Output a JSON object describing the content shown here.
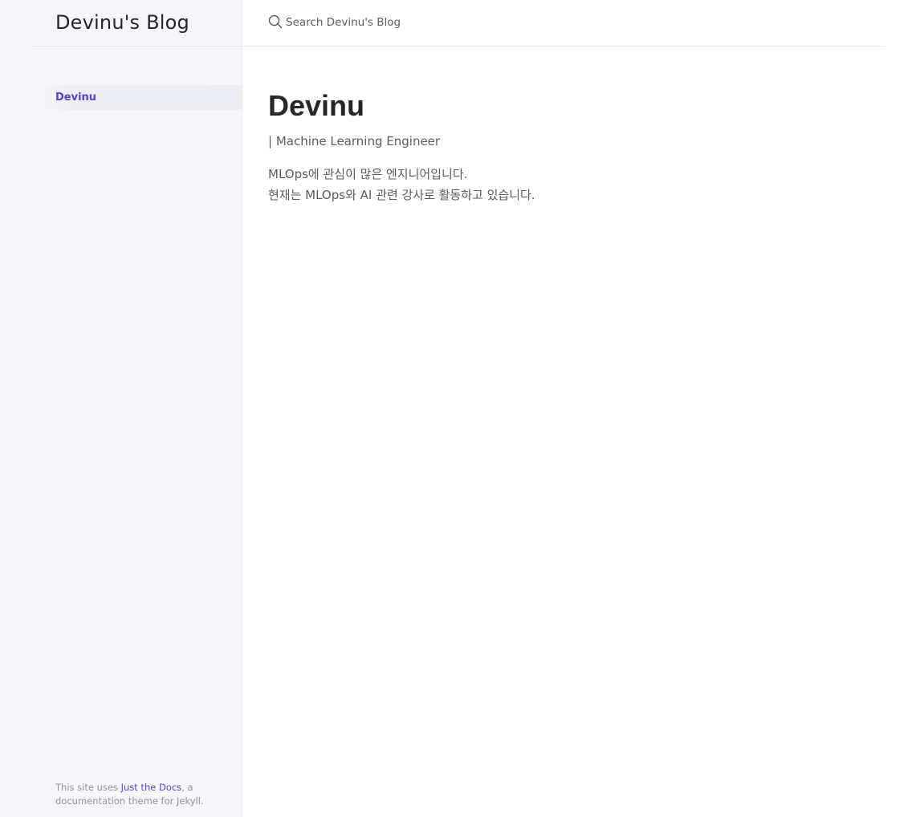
{
  "site": {
    "title": "Devinu's Blog"
  },
  "nav": {
    "items": [
      {
        "label": "Devinu"
      }
    ]
  },
  "search": {
    "placeholder": "Search Devinu's Blog"
  },
  "main": {
    "title": "Devinu",
    "subtitle": "| Machine Learning Engineer",
    "bio_lines": [
      "MLOps에 관심이 많은 엔지니어입니다.",
      "현재는 MLOps와 AI 관련 강사로 활동하고 있습니다."
    ]
  },
  "footer": {
    "prefix": "This site uses ",
    "link_label": "Just the Docs",
    "suffix": ", a documentation theme for Jekyll."
  },
  "colors": {
    "accent": "#5c3fd0",
    "sidebar_bg": "#f5f6fa",
    "text": "#5c5962",
    "heading": "#27262b"
  },
  "icons": {
    "search": "search-icon"
  }
}
